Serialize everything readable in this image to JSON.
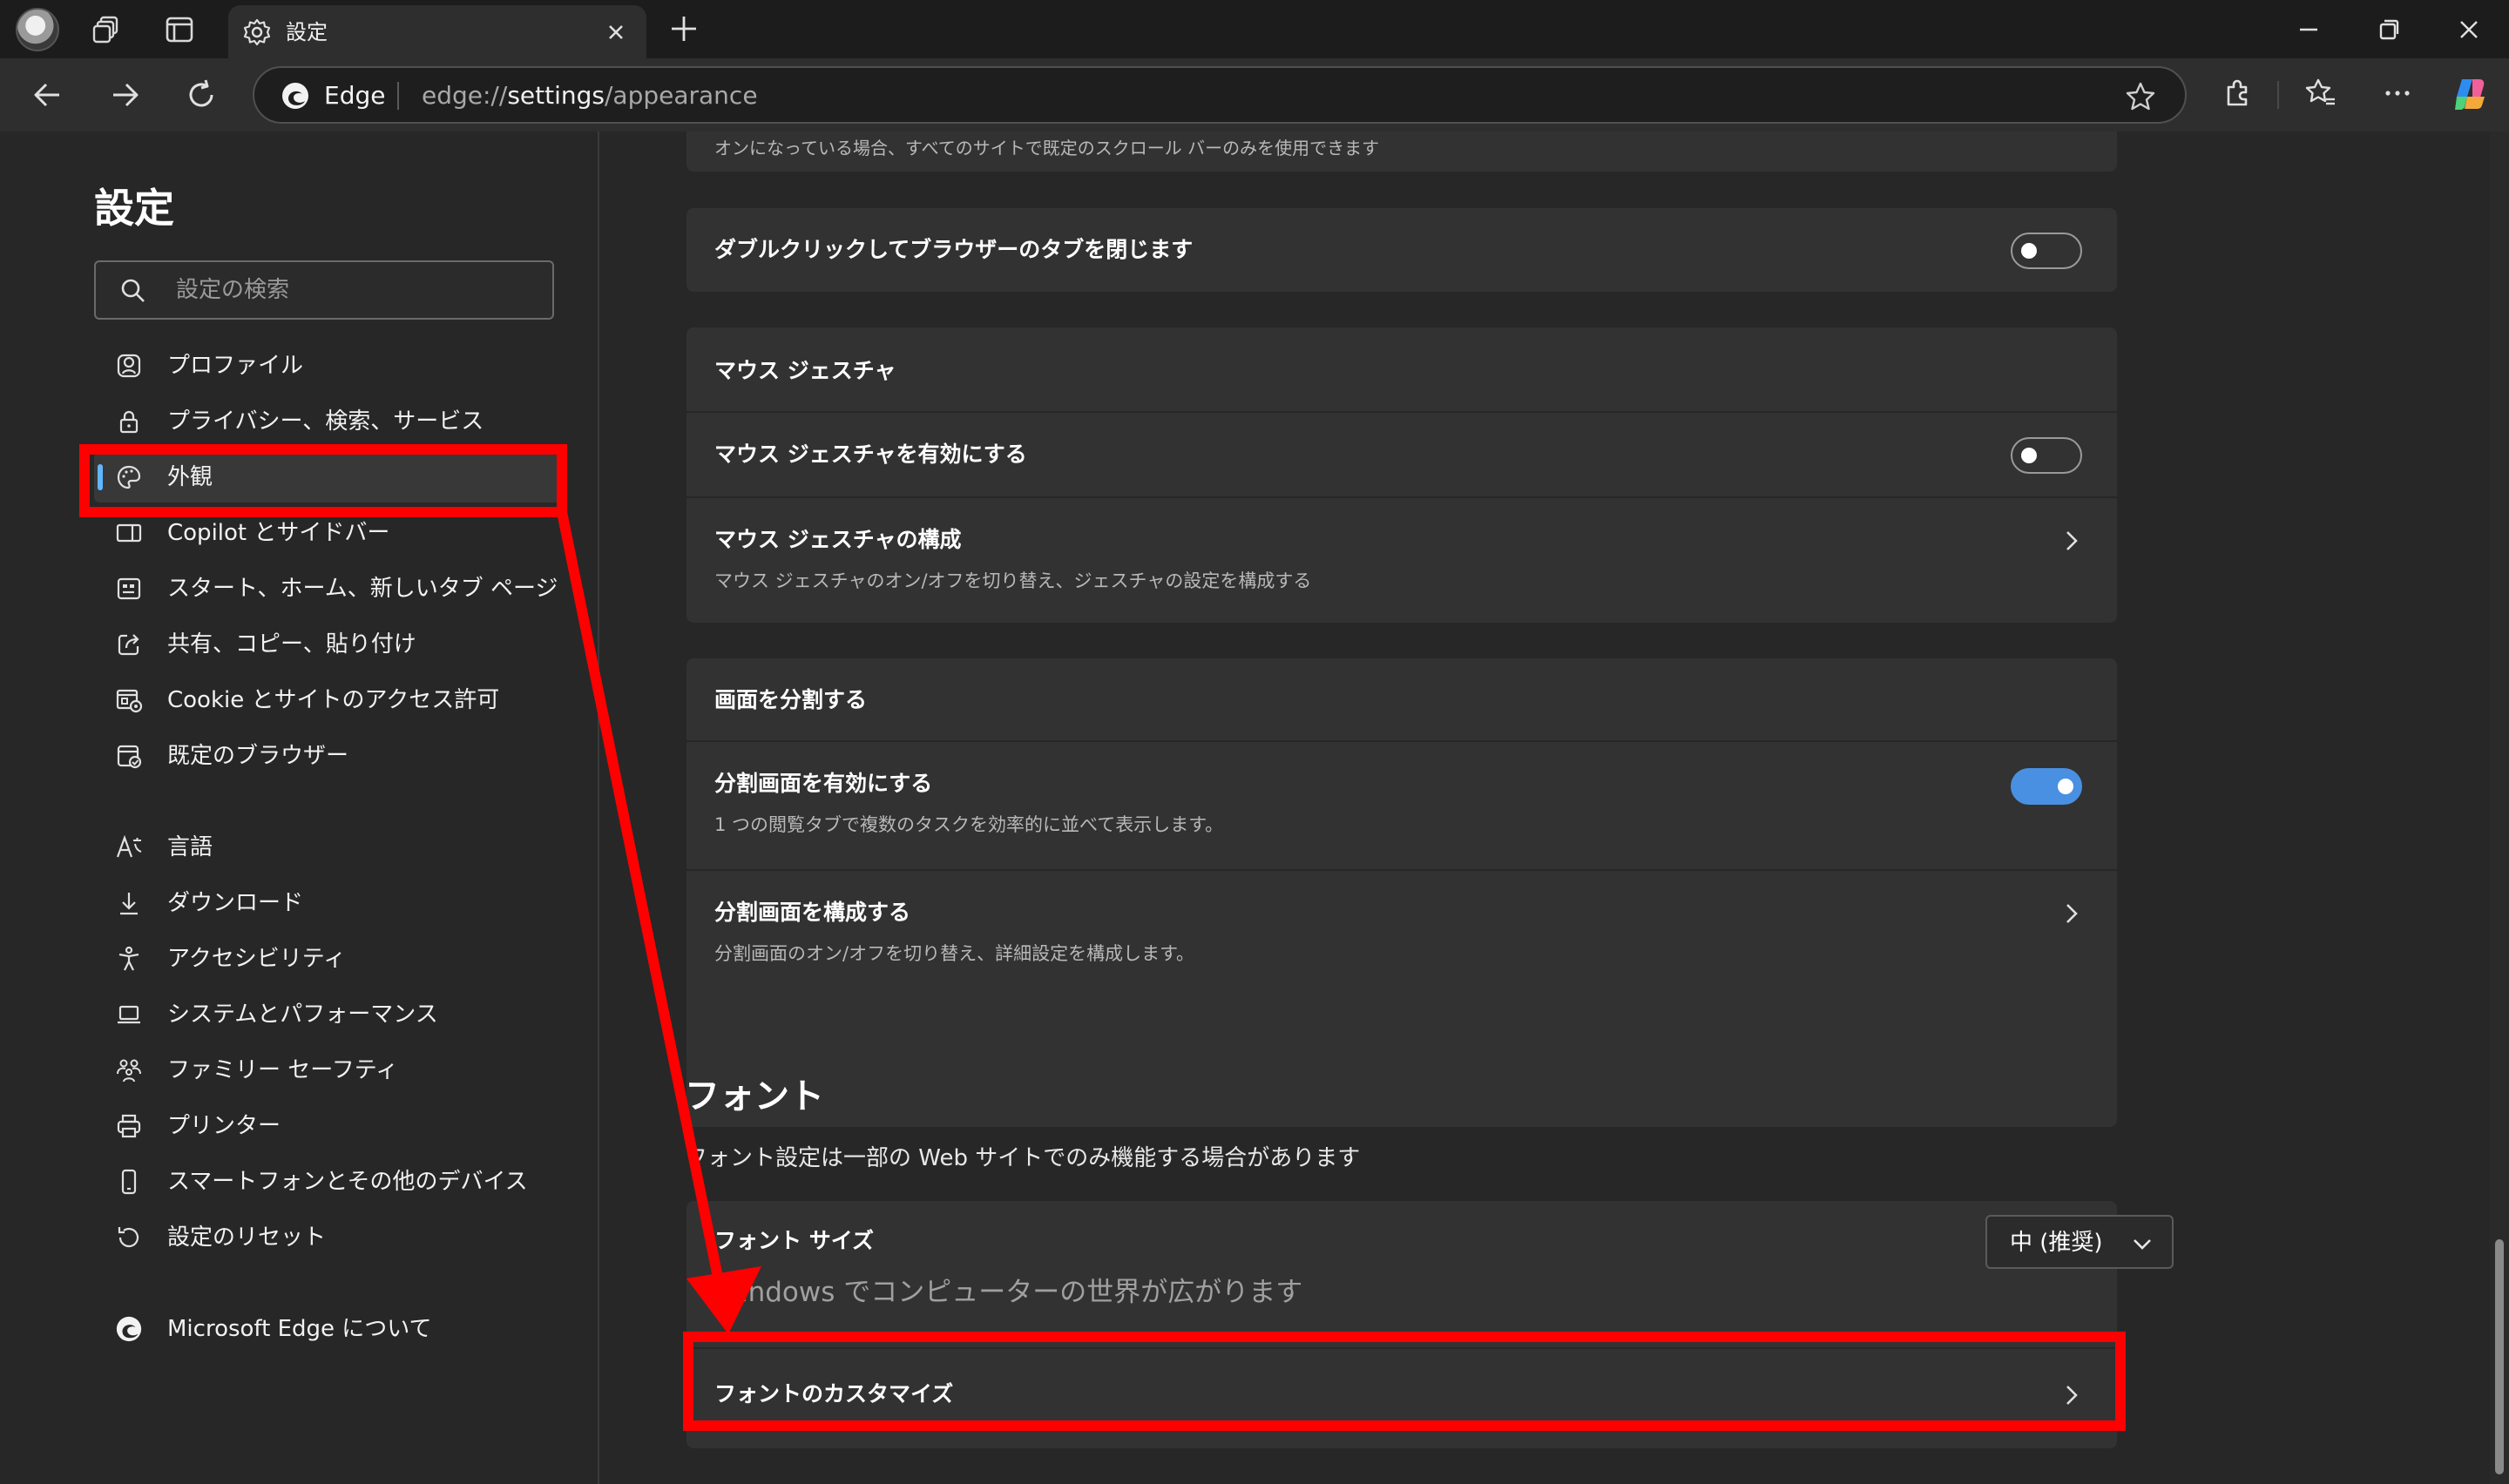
{
  "browser": {
    "tab_title": "設定",
    "site_label": "Edge",
    "url_scheme": "edge://",
    "url_host": "settings",
    "url_path": "/appearance"
  },
  "sidebar": {
    "title": "設定",
    "search_placeholder": "設定の検索",
    "items": [
      {
        "label": "プロファイル",
        "icon": "profile-icon"
      },
      {
        "label": "プライバシー、検索、サービス",
        "icon": "lock-icon"
      },
      {
        "label": "外観",
        "icon": "palette-icon",
        "active": true
      },
      {
        "label": "Copilot とサイドバー",
        "icon": "sidebar-icon"
      },
      {
        "label": "スタート、ホーム、新しいタブ ページ",
        "icon": "home-tab-icon"
      },
      {
        "label": "共有、コピー、貼り付け",
        "icon": "share-icon"
      },
      {
        "label": "Cookie とサイトのアクセス許可",
        "icon": "cookie-permissions-icon"
      },
      {
        "label": "既定のブラウザー",
        "icon": "default-browser-icon"
      },
      {
        "label": "言語",
        "icon": "language-icon"
      },
      {
        "label": "ダウンロード",
        "icon": "download-icon"
      },
      {
        "label": "アクセシビリティ",
        "icon": "accessibility-icon"
      },
      {
        "label": "システムとパフォーマンス",
        "icon": "laptop-icon"
      },
      {
        "label": "ファミリー セーフティ",
        "icon": "family-icon"
      },
      {
        "label": "プリンター",
        "icon": "printer-icon"
      },
      {
        "label": "スマートフォンとその他のデバイス",
        "icon": "phone-icon"
      },
      {
        "label": "設定のリセット",
        "icon": "reset-icon"
      },
      {
        "label": "Microsoft Edge について",
        "icon": "edge-logo-icon"
      }
    ]
  },
  "main": {
    "scrollbar_hint": "オンになっている場合、すべてのサイトで既定のスクロール バーのみを使用できます",
    "double_click": {
      "title": "ダブルクリックしてブラウザーのタブを閉じます",
      "enabled": false
    },
    "mouse_gesture": {
      "header": "マウス ジェスチャ",
      "enable_title": "マウス ジェスチャを有効にする",
      "enabled": false,
      "config_title": "マウス ジェスチャの構成",
      "config_desc": "マウス ジェスチャのオン/オフを切り替え、ジェスチャの設定を構成する"
    },
    "split_screen": {
      "header": "画面を分割する",
      "enable_title": "分割画面を有効にする",
      "enable_desc": "1 つの閲覧タブで複数のタスクを効率的に並べて表示します。",
      "enabled": true,
      "config_title": "分割画面を構成する",
      "config_desc": "分割画面のオン/オフを切り替え、詳細設定を構成します。"
    },
    "fonts": {
      "heading": "フォント",
      "desc": "フォント設定は一部の Web サイトでのみ機能する場合があります",
      "size_title": "フォント サイズ",
      "size_value": "中 (推奨)",
      "preview": "Windows でコンピューターの世界が広がります",
      "customize_title": "フォントのカスタマイズ"
    }
  },
  "colors": {
    "accent": "#60b6ff",
    "toggle_on": "#4a90e2",
    "annotation_red": "#ff0000"
  }
}
